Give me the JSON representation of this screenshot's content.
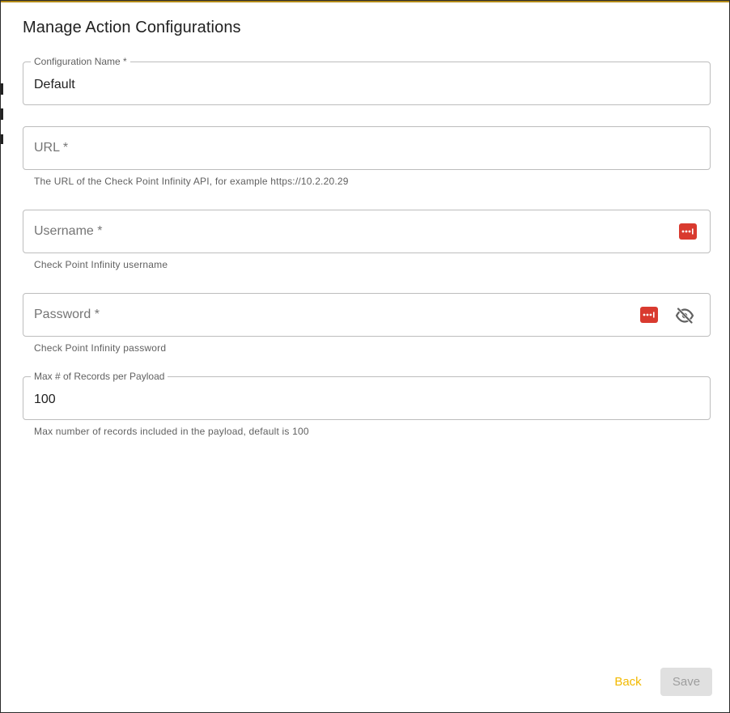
{
  "dialog": {
    "title": "Manage Action Configurations"
  },
  "fields": {
    "config_name": {
      "label": "Configuration Name *",
      "value": "Default"
    },
    "url": {
      "placeholder": "URL *",
      "helper": "The URL of the Check Point Infinity API, for example https://10.2.20.29"
    },
    "username": {
      "placeholder": "Username *",
      "helper": "Check Point Infinity username"
    },
    "password": {
      "placeholder": "Password *",
      "helper": "Check Point Infinity password"
    },
    "max_records": {
      "label": "Max # of Records per Payload",
      "value": "100",
      "helper": "Max number of records included in the payload, default is 100"
    }
  },
  "actions": {
    "back_label": "Back",
    "save_label": "Save"
  },
  "colors": {
    "accent_yellow": "#f2b900",
    "password_manager_red": "#d93a2f",
    "disabled_gray": "#e0e0e0"
  },
  "icons": {
    "username_field": "password-manager-icon",
    "password_field": [
      "password-manager-icon",
      "eye-off-icon"
    ]
  }
}
